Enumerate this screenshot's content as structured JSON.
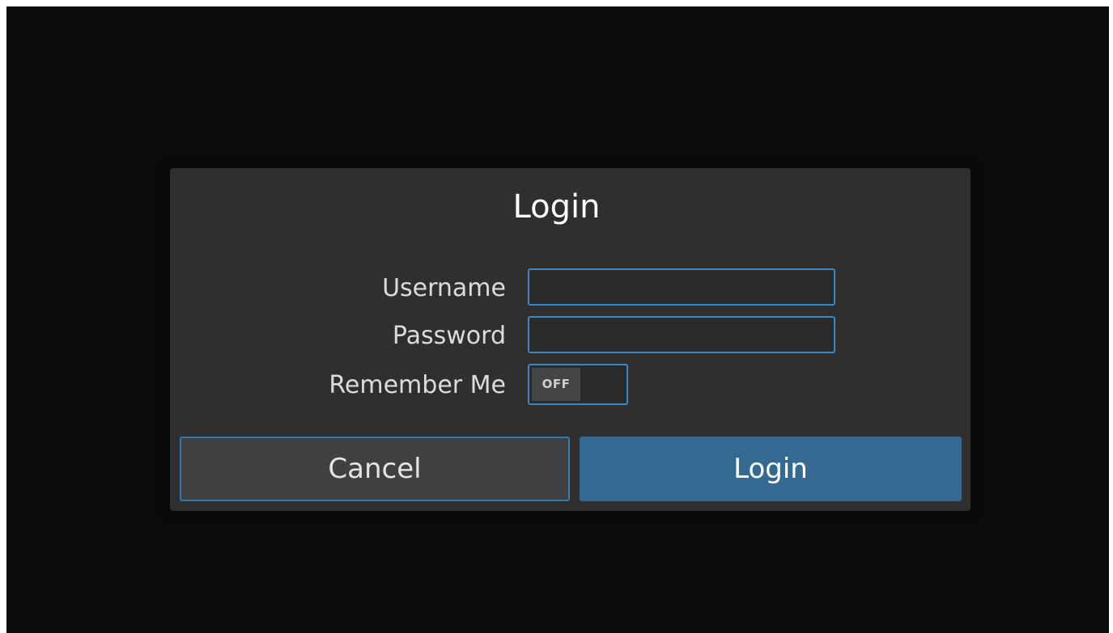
{
  "dialog": {
    "title": "Login",
    "username_label": "Username",
    "username_value": "",
    "password_label": "Password",
    "password_value": "",
    "remember_label": "Remember Me",
    "remember_state": "OFF",
    "cancel_label": "Cancel",
    "login_label": "Login"
  },
  "colors": {
    "background": "#0b0b0b",
    "dialog": "#2f2f2f",
    "accent_border": "#3f86c0",
    "primary_button": "#346a92"
  }
}
